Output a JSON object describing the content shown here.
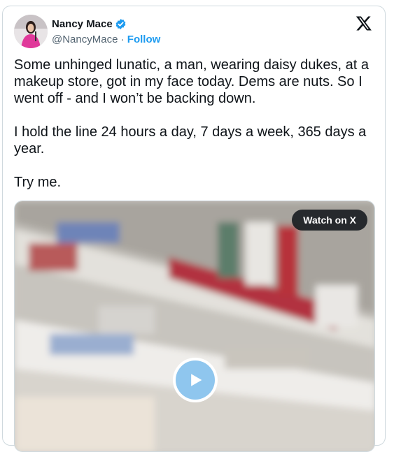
{
  "author": {
    "name": "Nancy Mace",
    "handle": "@NancyMace",
    "separator": " · ",
    "follow_label": "Follow"
  },
  "tweet": {
    "text": "Some unhinged lunatic, a man, wearing daisy dukes, at a makeup store, got in my face today. Dems are nuts. So I went off - and I won’t be backing down.\n\nI hold the line 24 hours a day, 7 days a week, 365 days a year.\n\nTry me."
  },
  "media": {
    "watch_label": "Watch on X"
  },
  "icons": {
    "verified": "verified-badge-icon",
    "platform": "x-logo-icon",
    "play": "play-icon"
  },
  "colors": {
    "accent": "#1d9bf0",
    "text": "#0f1419",
    "secondary": "#536471",
    "border": "#cfd9de"
  }
}
